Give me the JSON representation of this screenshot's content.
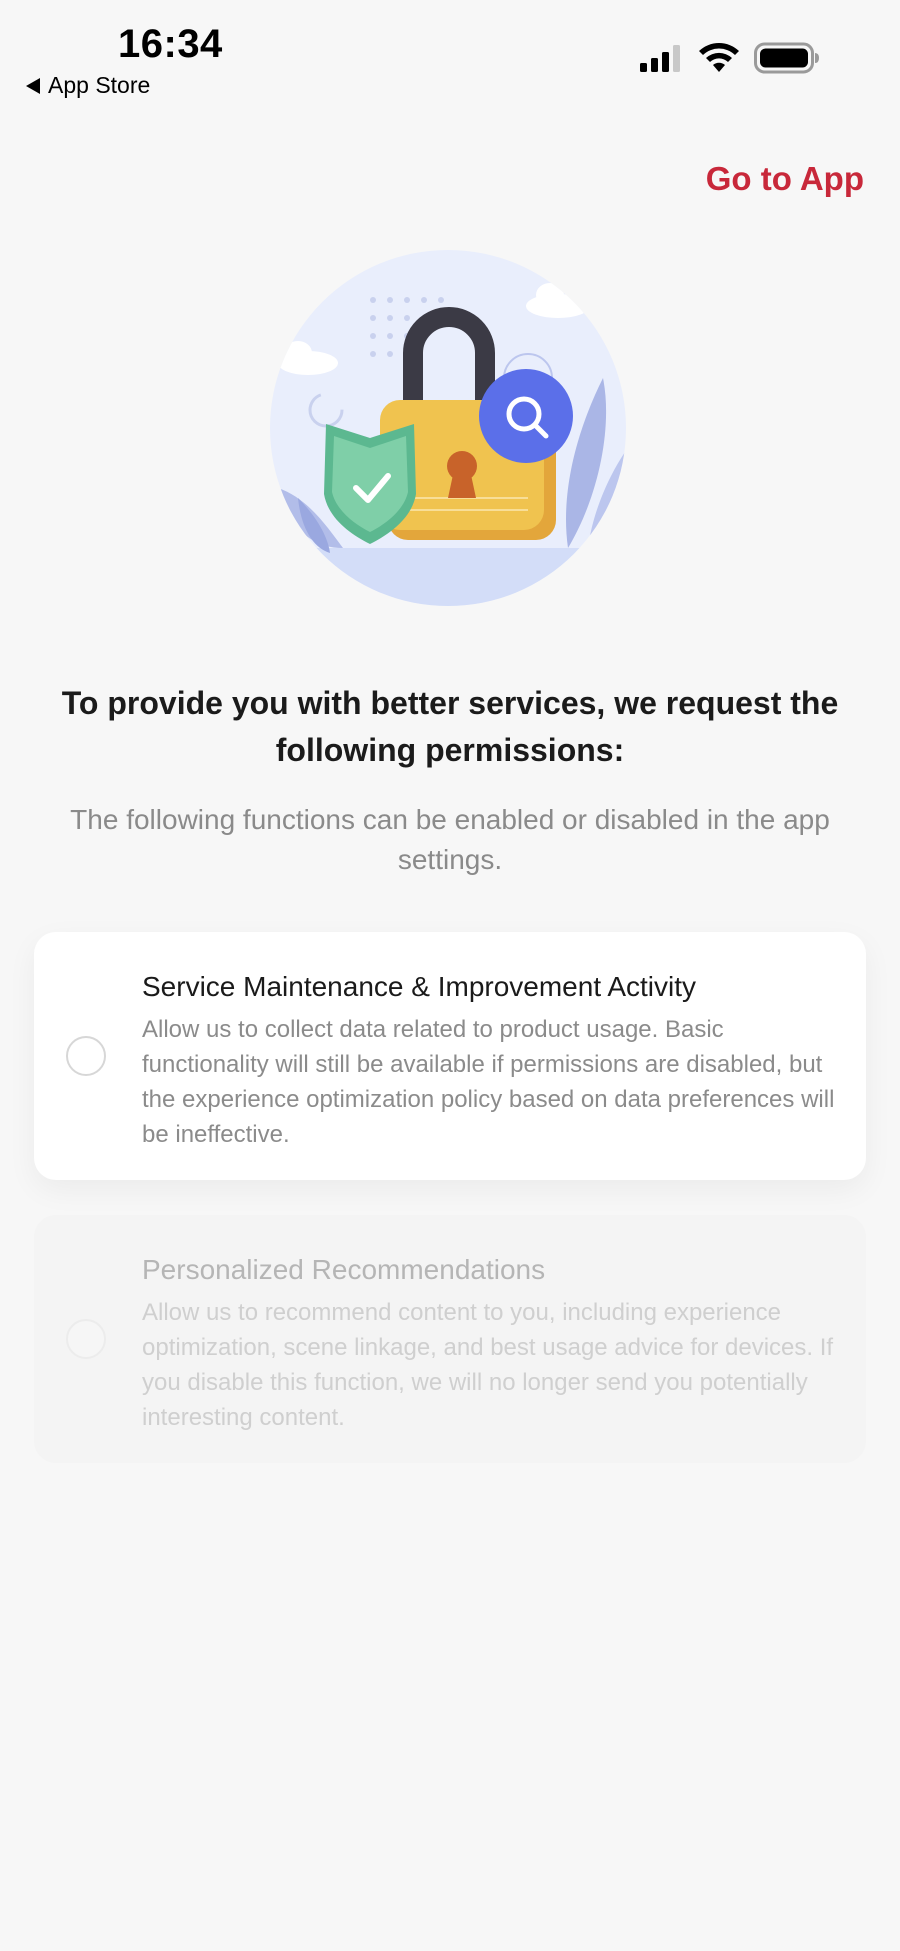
{
  "status_bar": {
    "time": "16:34",
    "back_label": "App Store"
  },
  "header": {
    "go_to_app": "Go to App"
  },
  "headline": "To provide you with better services, we request the following permissions:",
  "subtext": "The following functions can be enabled or disabled in the app settings.",
  "permissions": [
    {
      "title": "Service Maintenance & Improvement Activity",
      "description": "Allow us to collect data related to product usage. Basic functionality will still be available if permissions are disabled, but the experience optimization policy based on data preferences will be ineffective."
    },
    {
      "title": "Personalized Recommendations",
      "description": "Allow us to recommend content to you, including experience optimization, scene linkage, and best usage advice for devices. If you disable this function, we will no longer send you potentially interesting content."
    }
  ],
  "colors": {
    "accent": "#c8283a",
    "background": "#f7f7f7",
    "card": "#ffffff"
  }
}
